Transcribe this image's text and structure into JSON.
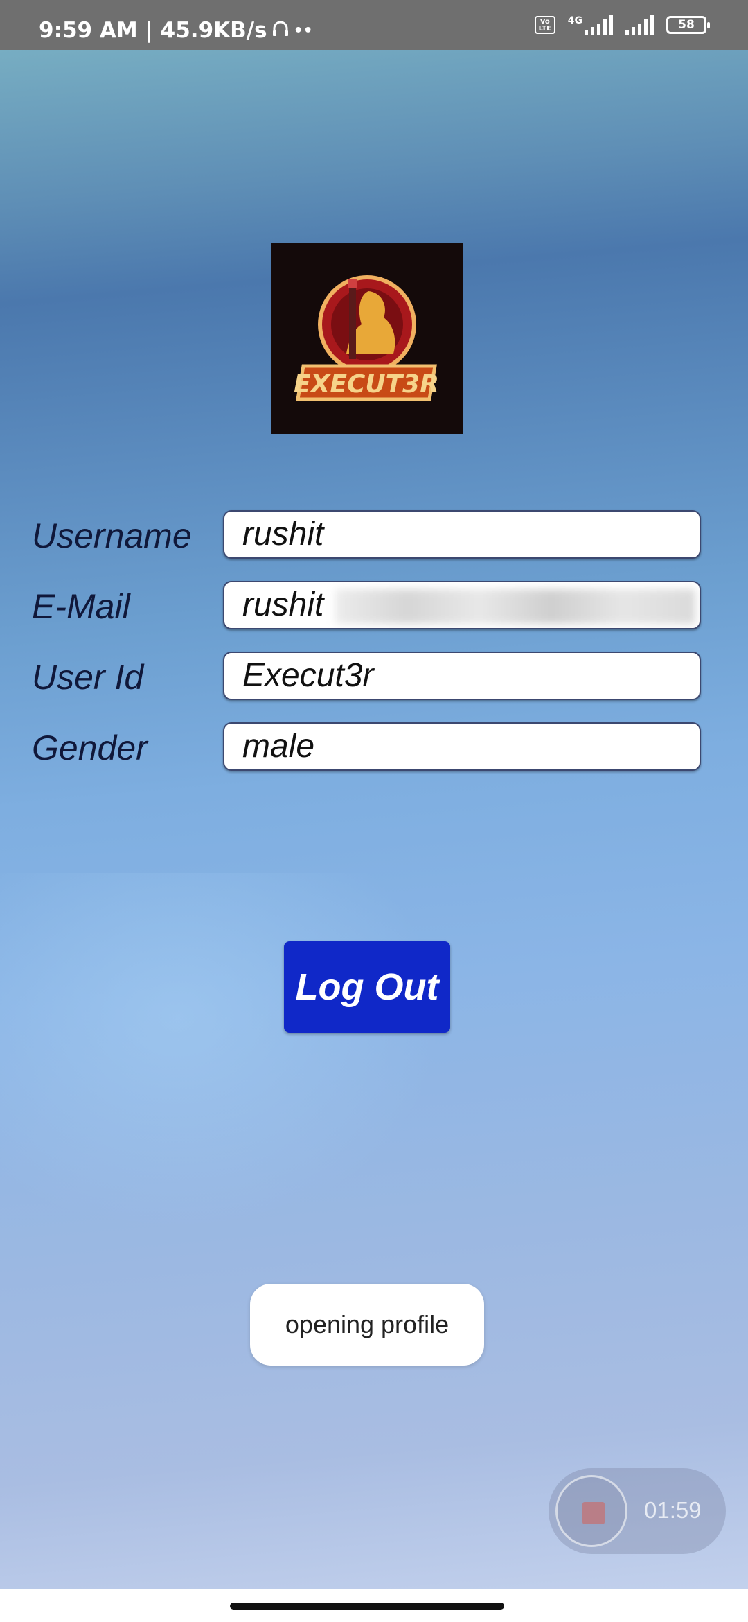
{
  "status_bar": {
    "time_speed": "9:59 AM | 45.9KB/s",
    "extra_icons": "••",
    "volte_label": "Vo LTE",
    "network_label": "4G",
    "battery": "58"
  },
  "logo": {
    "text": "EXECUT3R"
  },
  "form": {
    "fields": [
      {
        "label": "Username",
        "value": "rushit"
      },
      {
        "label": "E-Mail",
        "value": "rushit"
      },
      {
        "label": "User Id",
        "value": "Execut3r"
      },
      {
        "label": "Gender",
        "value": "male"
      }
    ]
  },
  "actions": {
    "logout_label": "Log Out"
  },
  "toast": {
    "message": "opening profile"
  },
  "recorder": {
    "time": "01:59"
  },
  "colors": {
    "logout_button": "#1028c8",
    "status_bar": "#6f6f6f"
  }
}
